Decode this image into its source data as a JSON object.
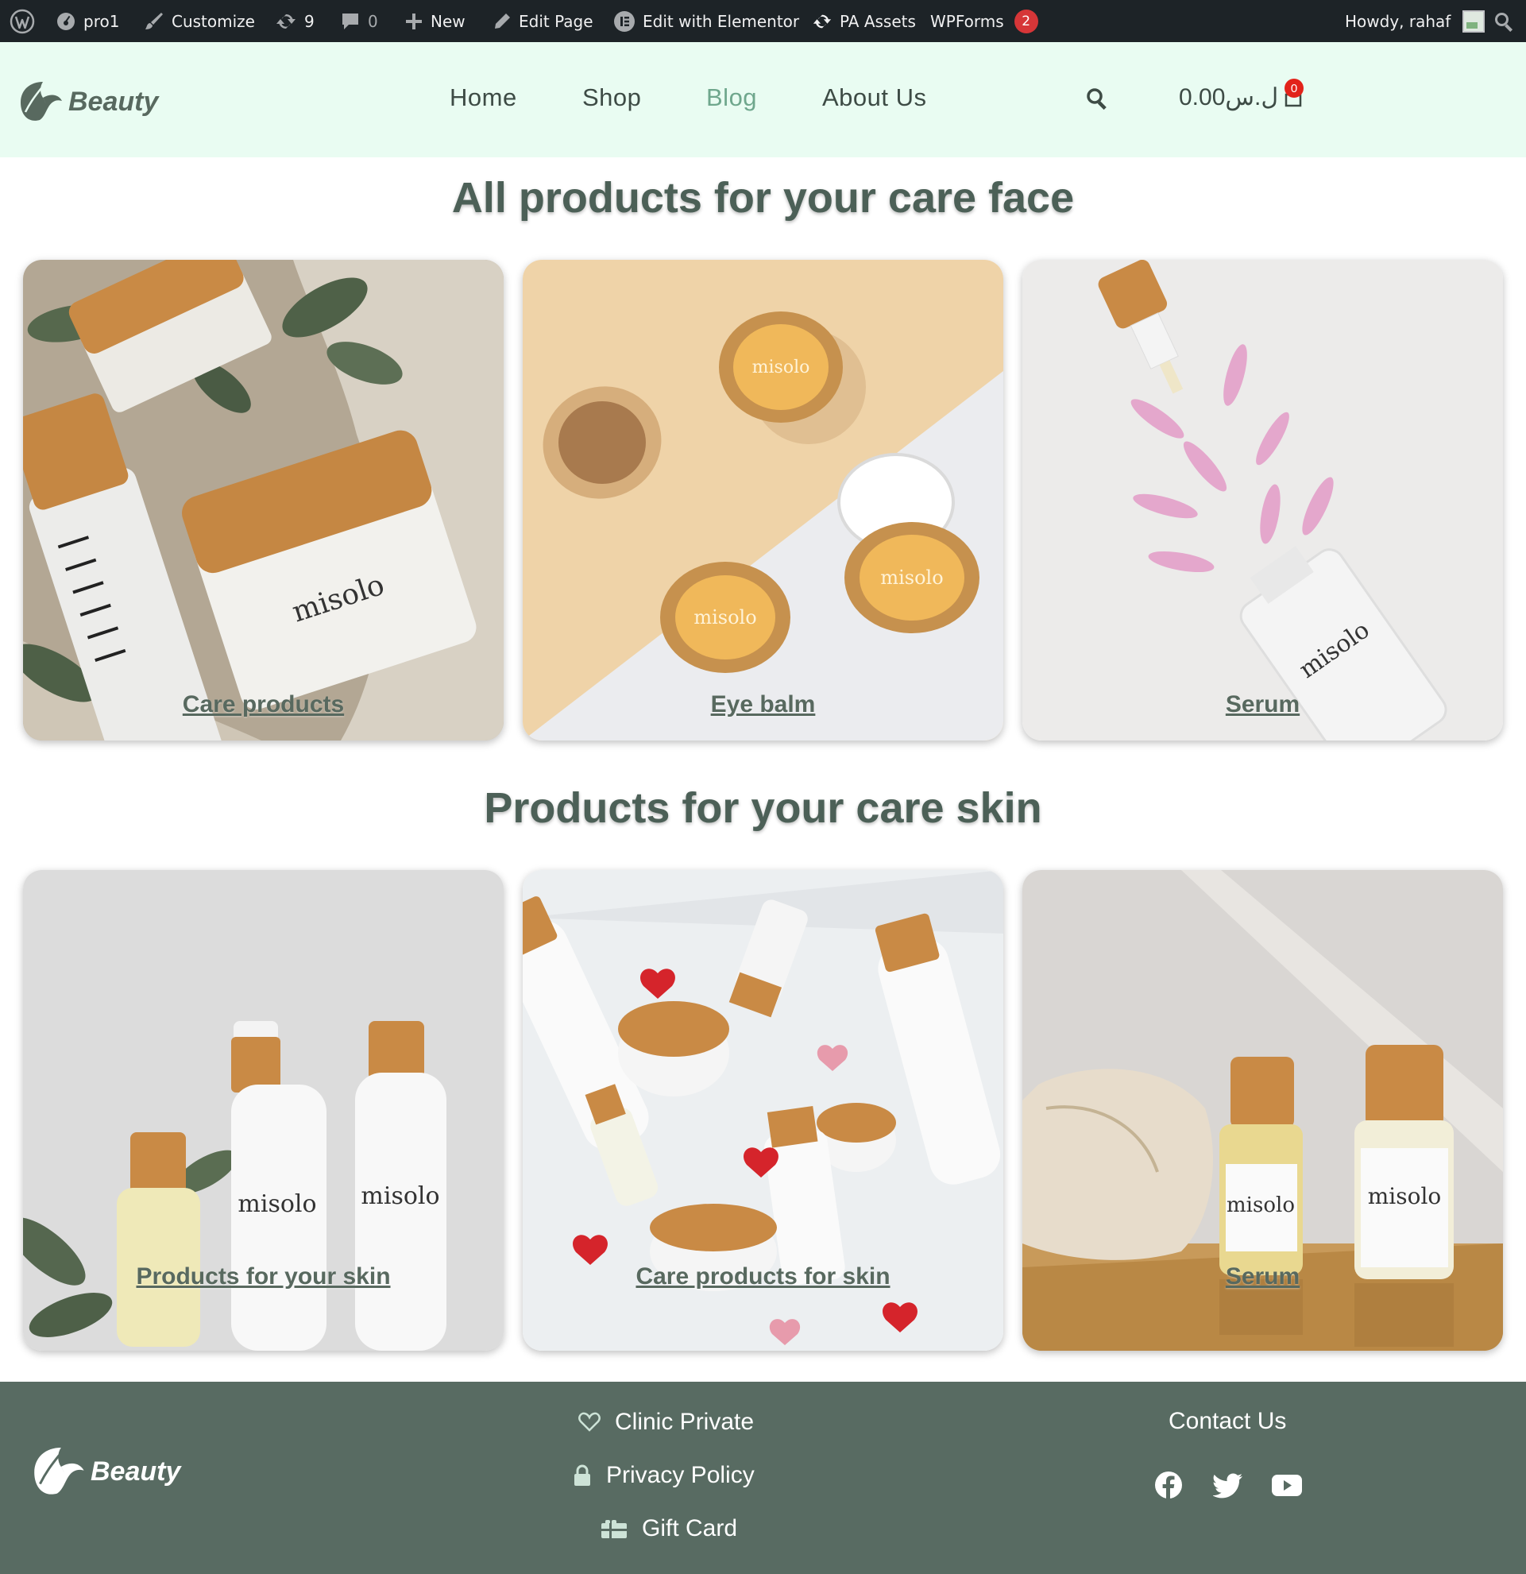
{
  "admin_bar": {
    "site_name": "pro1",
    "customize": "Customize",
    "updates_count": "9",
    "comments_count": "0",
    "new_label": "New",
    "edit_page": "Edit Page",
    "edit_elementor": "Edit with Elementor",
    "pa_assets": "PA Assets",
    "wpforms": "WPForms",
    "wpforms_badge": "2",
    "howdy": "Howdy, rahaf"
  },
  "header": {
    "logo_text": "Beauty",
    "nav": [
      {
        "label": "Home",
        "active": false
      },
      {
        "label": "Shop",
        "active": false
      },
      {
        "label": "Blog",
        "active": true
      },
      {
        "label": "About Us",
        "active": false
      }
    ],
    "cart_total": "0.00ل.س",
    "cart_count": "0"
  },
  "sections": [
    {
      "title": "All products for your care face",
      "cards": [
        {
          "label": "Care products"
        },
        {
          "label": "Eye balm"
        },
        {
          "label": "Serum"
        }
      ]
    },
    {
      "title": "Products for your care skin",
      "cards": [
        {
          "label": "Products for your skin"
        },
        {
          "label": "Care products for skin"
        },
        {
          "label": "Serum"
        }
      ]
    }
  ],
  "product_brand_mark": "misolo",
  "footer": {
    "logo_text": "Beauty",
    "links": [
      {
        "label": "Clinic Private",
        "icon": "heart-icon"
      },
      {
        "label": "Privacy Policy",
        "icon": "lock-icon"
      },
      {
        "label": "Gift Card",
        "icon": "gift-card-icon"
      }
    ],
    "contact_title": "Contact Us",
    "social": [
      "facebook-icon",
      "twitter-icon",
      "youtube-icon"
    ]
  },
  "colors": {
    "admin_bar_bg": "#1d2327",
    "header_bg": "#e9fcf2",
    "heading_green": "#4c6057",
    "nav_active": "#6fa78d",
    "footer_bg": "#586b62",
    "badge_red": "#d63638"
  }
}
